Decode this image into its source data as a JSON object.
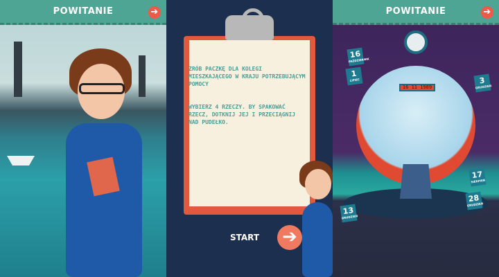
{
  "screens": [
    {
      "header": {
        "title": "POWITANIE",
        "next_icon": "arrow-right-icon"
      }
    },
    {
      "instructions": {
        "line1": "ZRÓB PACZKĘ DLA KOLEGI MIESZKAJĄCEGO W KRAJU POTRZEBUJĄCYM POMOCY",
        "line2": "WYBIERZ 4 RZECZY. BY SPAKOWAĆ RZECZ, DOTKNIJ JEJ I PRZECIĄGNIJ NAD PUDEŁKO."
      },
      "start_label": "START"
    },
    {
      "header": {
        "title": "POWITANIE",
        "next_icon": "arrow-right-icon"
      },
      "time_machine_date": "16 11 1989",
      "calendars": [
        {
          "day": "16",
          "month": "PAŹDZIERNIK"
        },
        {
          "day": "1",
          "month": "LIPIEC"
        },
        {
          "day": "3",
          "month": "GRUDZIEŃ"
        },
        {
          "day": "17",
          "month": "SIERPIEŃ"
        },
        {
          "day": "28",
          "month": "GRUDZIEŃ"
        },
        {
          "day": "13",
          "month": "GRUDZIEŃ"
        }
      ]
    }
  ],
  "colors": {
    "header": "#4fa593",
    "accent": "#ee5a48",
    "text_teal": "#4a9e96"
  }
}
